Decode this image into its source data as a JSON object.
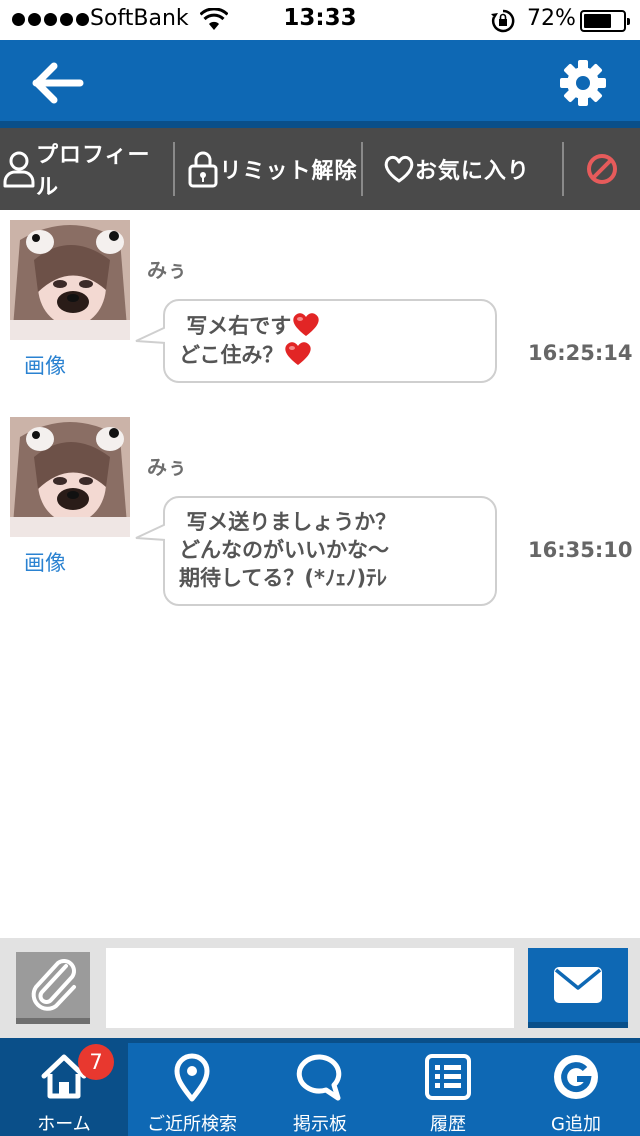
{
  "status_bar": {
    "carrier": "SoftBank",
    "time": "13:33",
    "battery_percent": "72%",
    "battery_level": 0.72
  },
  "header": {
    "back_icon": "arrow-left-icon",
    "settings_icon": "gear-icon"
  },
  "actions": {
    "profile": "プロフィール",
    "limit_release": "リミット解除",
    "favorite": "お気に入り",
    "block_icon": "block-icon"
  },
  "messages": [
    {
      "sender": "みぅ",
      "image_link": "画像",
      "lines": [
        "写メ右です",
        "どこ住み？"
      ],
      "time": "16:25:14"
    },
    {
      "sender": "みぅ",
      "image_link": "画像",
      "lines": [
        "写メ送りましょうか？",
        "どんなのがいいかな〜",
        "期待してる？(*ﾉｪﾉ)ﾃﾚ"
      ],
      "time": "16:35:10"
    }
  ],
  "composer": {
    "attach_icon": "paperclip-icon",
    "input_value": "",
    "send_icon": "envelope-icon"
  },
  "tabs": [
    {
      "label": "ホーム",
      "icon": "home-icon",
      "badge": "7",
      "active": true
    },
    {
      "label": "ご近所検索",
      "icon": "location-pin-icon"
    },
    {
      "label": "掲示板",
      "icon": "speech-bubble-icon"
    },
    {
      "label": "履歴",
      "icon": "list-icon"
    },
    {
      "label": "G追加",
      "icon": "g-icon"
    }
  ],
  "colors": {
    "primary": "#0e68b4",
    "primary_dark": "#0a4f89",
    "action_bar": "#4a4a4a",
    "link": "#2a82d1",
    "badge": "#e8382f",
    "block": "#e65b5b"
  }
}
